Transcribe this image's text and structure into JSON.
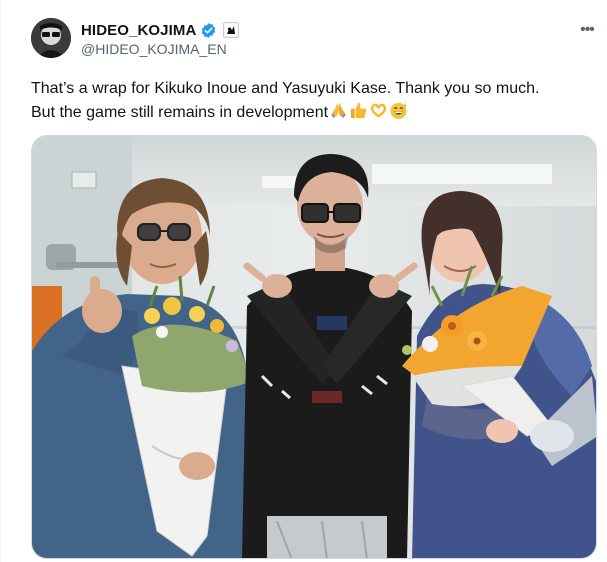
{
  "author": {
    "display_name": "HIDEO_KOJIMA",
    "handle": "@HIDEO_KOJIMA_EN",
    "verified": true,
    "verified_color": "#1d9bf0",
    "avatar_icon": "avatar-photo"
  },
  "menu": {
    "more_label": "•••"
  },
  "tweet": {
    "line1": "That’s a wrap for Kikuko Inoue and Yasuyuki Kase. Thank you so much.",
    "line2": "But the game still remains in development",
    "emojis": [
      "folded-hands-emoji",
      "thumbs-up-emoji",
      "heart-hands-emoji",
      "grinning-sweat-emoji"
    ]
  },
  "media": {
    "type": "photo"
  },
  "colors": {
    "text": "#0f1419",
    "secondary": "#536471",
    "border": "#cfd9de"
  }
}
